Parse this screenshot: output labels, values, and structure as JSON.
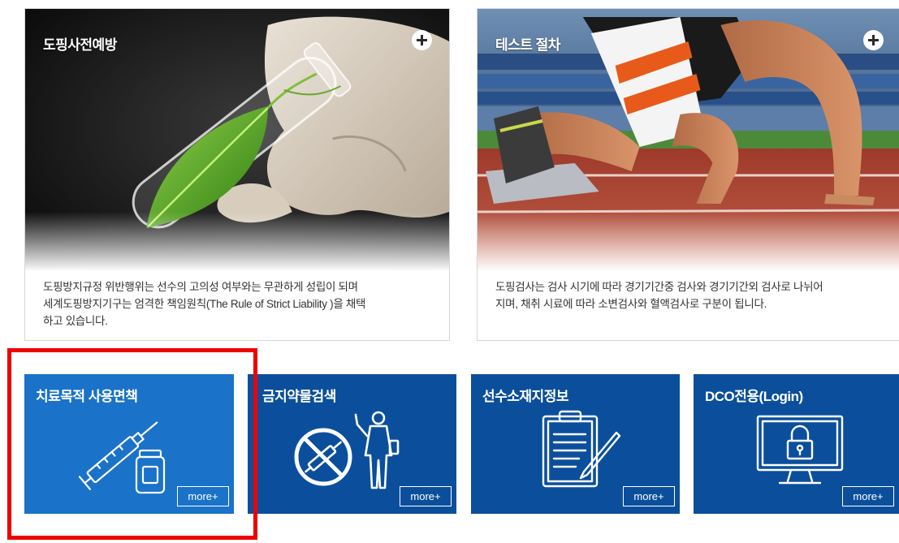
{
  "cards": [
    {
      "title": "도핑사전예방",
      "plus_icon": "plus-circle-icon",
      "photo": "test-tube-leaf-photo",
      "description": [
        "도핑방지규정 위반행위는 선수의 고의성 여부와는 무관하게 성립이 되며",
        "세계도핑방지기구는 엄격한 책임원칙(The Rule of Strict Liability )을 채택",
        "하고 있습니다."
      ]
    },
    {
      "title": "테스트 절차",
      "plus_icon": "plus-circle-icon",
      "photo": "sprinter-start-photo",
      "description": [
        "도핑검사는 검사 시기에 따라 경기기간중 검사와 경기기간외 검사로 나뉘어",
        "지며, 채취 시료에 따라 소변검사와 혈액검사로 구분이 됩니다."
      ]
    }
  ],
  "tiles": [
    {
      "label": "치료목적 사용면책",
      "icon": "syringe-vial-icon",
      "more": "more+",
      "color": "#1a72c9"
    },
    {
      "label": "금지약물검색",
      "icon": "prohibited-substance-icon",
      "more": "more+",
      "color": "#0b4f9c"
    },
    {
      "label": "선수소재지정보",
      "icon": "clipboard-pen-icon",
      "more": "more+",
      "color": "#0b4f9c"
    },
    {
      "label": "DCO전용(Login)",
      "icon": "monitor-lock-icon",
      "more": "more+",
      "color": "#0b4f9c"
    }
  ],
  "highlight_color": "#ee0000"
}
